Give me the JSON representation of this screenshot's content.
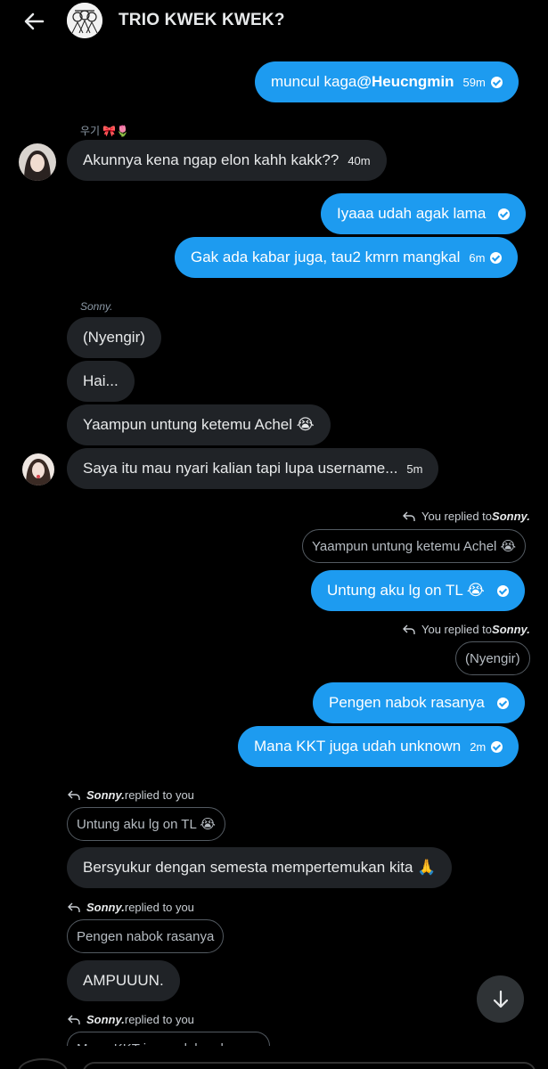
{
  "header": {
    "title": "TRIO KWEK KWEK?"
  },
  "messages": {
    "m1": {
      "text": "muncul kaga ",
      "mention": "@Heucngmin",
      "time": "59m"
    },
    "m2_sender": "우기 🎀🌷",
    "m2": {
      "text": "Akunnya kena ngap elon kahh kakk??",
      "time": "40m"
    },
    "m3": {
      "text": "Iyaaa udah agak lama"
    },
    "m4": {
      "text": "Gak ada kabar juga, tau2 kmrn mangkal",
      "time": "6m"
    },
    "m5_sender": "Sonny.",
    "m5": {
      "text": "(Nyengir)"
    },
    "m6": {
      "text": "Hai..."
    },
    "m7": {
      "text": "Yaampun untung ketemu Achel 😭"
    },
    "m8": {
      "text": "Saya itu mau nyari kalian tapi lupa username...",
      "time": "5m"
    },
    "r1": {
      "prefix": "You replied to ",
      "name": "Sonny."
    },
    "q1": "Yaampun untung ketemu Achel 😭",
    "m9": {
      "text": "Untung aku lg on TL 😭"
    },
    "r2": {
      "prefix": "You replied to ",
      "name": "Sonny."
    },
    "q2": "(Nyengir)",
    "m10": {
      "text": "Pengen nabok rasanya"
    },
    "m11": {
      "text": "Mana KKT juga udah unknown",
      "time": "2m"
    },
    "r3": {
      "name": "Sonny.",
      "suffix": " replied to you"
    },
    "q3": "Untung aku lg on TL 😭",
    "m12": {
      "text": "Bersyukur dengan semesta mempertemukan kita 🙏"
    },
    "r4": {
      "name": "Sonny.",
      "suffix": " replied to you"
    },
    "q4": "Pengen nabok rasanya",
    "m13": {
      "text": "AMPUUUN."
    },
    "r5": {
      "name": "Sonny.",
      "suffix": " replied to you"
    },
    "q5": "Mana KKT juga udah unknown"
  },
  "colors": {
    "accent": "#1d9bf0",
    "incoming": "#202327",
    "background": "#000000"
  },
  "icons": {
    "back": "arrow-left-icon",
    "scroll": "arrow-down-icon",
    "reply": "reply-arrow-icon",
    "read": "check-circle-icon"
  }
}
